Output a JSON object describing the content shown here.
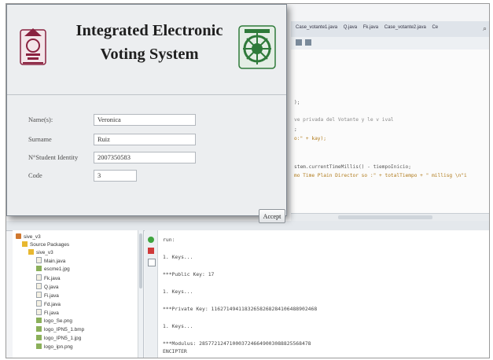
{
  "dialog": {
    "title_line1": "Integrated Electronic",
    "title_line2": "Voting System",
    "fields": [
      {
        "label": "Name(s):",
        "value": "Veronica"
      },
      {
        "label": "Surname",
        "value": "Ruiz"
      },
      {
        "label": "N°Student Identity",
        "value": "2007350583"
      },
      {
        "label": "Code",
        "value": "3"
      }
    ],
    "accept_label": "Accept"
  },
  "editor": {
    "tabs": [
      "Case_votante1.java",
      "Q.java",
      "Fk.java",
      "Case_votante2.java",
      "Ce"
    ],
    "code_lines": [
      ");",
      "ve privada del Votante y le v ival",
      ";",
      "o:\" + kay);",
      "stem.currentTimeMillis() - tiempoInicio;",
      "mo Time Plain Director so  :\" + totalTiempo + \" millisg \\n\"i"
    ]
  },
  "project_tree": {
    "project": "sive_v3",
    "source_packages": "Source Packages",
    "package": "sive_v3",
    "files": [
      "Main.java",
      "escme1.jpg",
      "Fk.java",
      "Q.java",
      "Fi.java",
      "Fd.java",
      "Fl.java",
      "logo_Se.png",
      "logo_IPN5_1.bmp",
      "logo_IPN5_1.jpg",
      "logo_ipn.png"
    ]
  },
  "output": {
    "lines": [
      "run:",
      "1. Keys...",
      "***Public Key: 17",
      "1. Keys...",
      "***Private Key: 11627149411832658268284106488902468",
      "1. Keys...",
      "***Modulus: 2857721247100037246649003088825568478",
      "ENCIPTER"
    ]
  },
  "colors": {
    "dialog_bg": "#eceef0",
    "logo_maroon": "#8a2240",
    "logo_green": "#2f7a3a"
  }
}
